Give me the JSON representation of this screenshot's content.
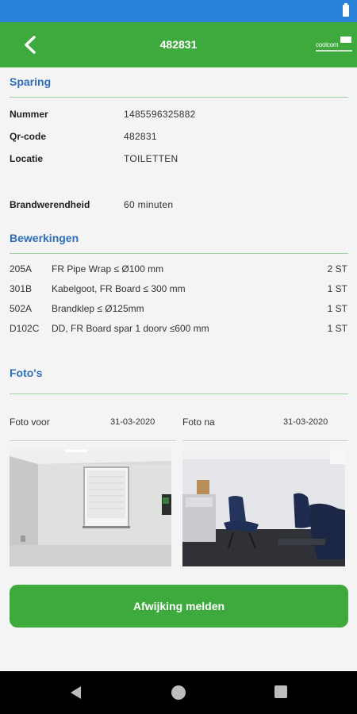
{
  "header": {
    "title": "482831",
    "logo_text": "coolcom"
  },
  "sparing": {
    "section_title": "Sparing",
    "fields": [
      {
        "label": "Nummer",
        "value": "1485596325882"
      },
      {
        "label": "Qr-code",
        "value": "482831"
      },
      {
        "label": "Locatie",
        "value": "TOILETTEN"
      }
    ],
    "brandwerendheid": {
      "label": "Brandwerendheid",
      "value": "60 minuten"
    }
  },
  "bewerkingen": {
    "section_title": "Bewerkingen",
    "items": [
      {
        "code": "205A",
        "description": "FR Pipe Wrap ≤ Ø100 mm",
        "quantity": "2 ST"
      },
      {
        "code": "301B",
        "description": "Kabelgoot, FR Board ≤ 300 mm",
        "quantity": "1 ST"
      },
      {
        "code": "502A",
        "description": "Brandklep ≤ Ø125mm",
        "quantity": "1 ST"
      },
      {
        "code": "D102C",
        "description": "DD, FR Board spar 1 doorv ≤600 mm",
        "quantity": "1 ST"
      }
    ]
  },
  "photos": {
    "section_title": "Foto's",
    "before": {
      "label": "Foto voor",
      "date": "31-03-2020"
    },
    "after": {
      "label": "Foto na",
      "date": "31-03-2020"
    }
  },
  "actions": {
    "report_label": "Afwijking melden"
  },
  "colors": {
    "primary_green": "#3eaa3e",
    "status_bar_blue": "#2b82d9",
    "section_title_blue": "#2c6fb8"
  }
}
